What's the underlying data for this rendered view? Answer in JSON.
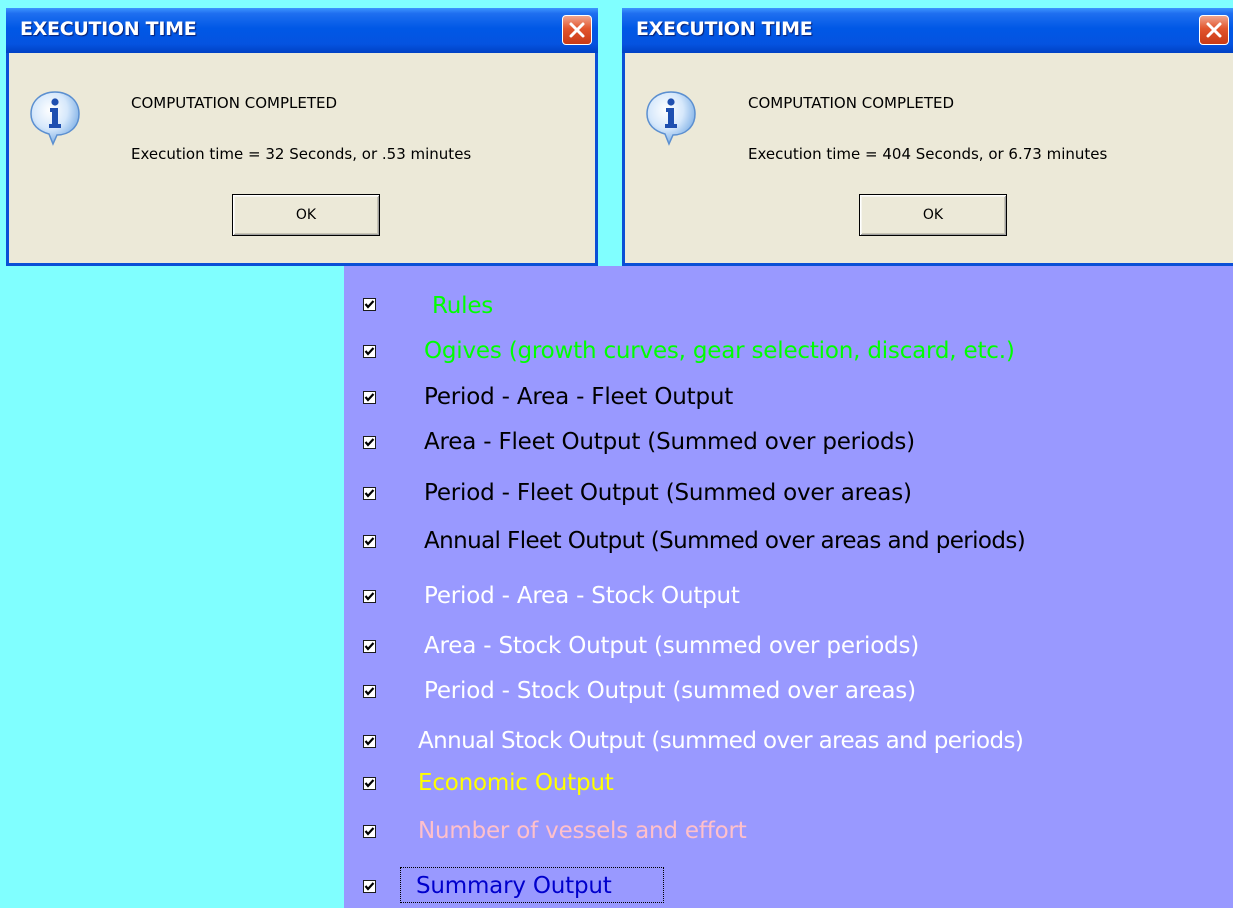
{
  "dialogs": [
    {
      "title": "EXECUTION TIME",
      "message": "COMPUTATION COMPLETED",
      "detail": "Execution time  =  32 Seconds, or  .53 minutes",
      "ok_label": "OK"
    },
    {
      "title": "EXECUTION TIME",
      "message": "COMPUTATION COMPLETED",
      "detail": "Execution time  =  404 Seconds, or  6.73 minutes",
      "ok_label": "OK"
    }
  ],
  "options": [
    {
      "label": "Rules",
      "checked": true,
      "color": "#00ff00"
    },
    {
      "label": "Ogives (growth curves, gear selection, discard, etc.)",
      "checked": true,
      "color": "#00ff00"
    },
    {
      "label": "Period - Area - Fleet Output",
      "checked": true,
      "color": "#000000"
    },
    {
      "label": "Area - Fleet Output (Summed over periods)",
      "checked": true,
      "color": "#000000"
    },
    {
      "label": "Period - Fleet Output (Summed over areas)",
      "checked": true,
      "color": "#000000"
    },
    {
      "label": "Annual Fleet Output (Summed over areas and periods)",
      "checked": true,
      "color": "#000000"
    },
    {
      "label": "Period - Area - Stock Output",
      "checked": true,
      "color": "#ffffff"
    },
    {
      "label": "Area - Stock Output (summed over periods)",
      "checked": true,
      "color": "#ffffff"
    },
    {
      "label": "Period - Stock Output (summed over areas)",
      "checked": true,
      "color": "#ffffff"
    },
    {
      "label": "Annual Stock Output (summed over areas and periods)",
      "checked": true,
      "color": "#ffffff"
    },
    {
      "label": "Economic Output",
      "checked": true,
      "color": "#ffff00"
    },
    {
      "label": "Number of vessels and effort",
      "checked": true,
      "color": "#ffc0cb"
    },
    {
      "label": "Summary Output",
      "checked": true,
      "color": "#0000cc"
    }
  ],
  "icons": {
    "dialog_icon": "info-icon",
    "close": "close-icon",
    "checkbox_mark": "checkmark-icon"
  }
}
